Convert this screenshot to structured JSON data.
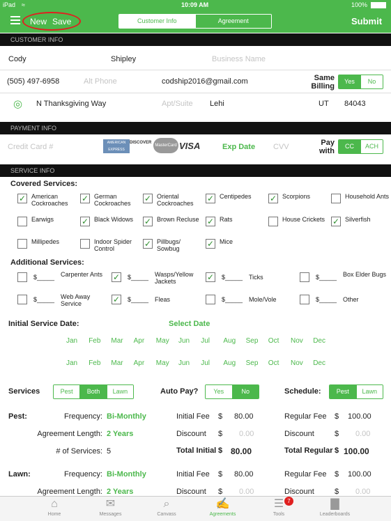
{
  "status": {
    "carrier": "iPad",
    "time": "10:09 AM",
    "battery": "100%"
  },
  "nav": {
    "new": "New",
    "save": "Save",
    "tabs": [
      "Customer Info",
      "Agreement"
    ],
    "submit": "Submit"
  },
  "sections": {
    "customer": "CUSTOMER INFO",
    "payment": "PAYMENT INFO",
    "service": "SERVICE INFO"
  },
  "customer": {
    "first": "Cody",
    "last": "Shipley",
    "business_ph": "Business Name",
    "phone": "(505) 497-6958",
    "alt_phone_ph": "Alt Phone",
    "email": "codship2016@gmail.com",
    "same_billing": "Same Billing",
    "yes": "Yes",
    "no": "No",
    "street": "N Thanksgiving Way",
    "apt_ph": "Apt/Suite",
    "city": "Lehi",
    "state": "UT",
    "zip": "84043"
  },
  "payment": {
    "cc_ph": "Credit Card #",
    "exp": "Exp Date",
    "cvv": "CVV",
    "pay_with": "Pay with",
    "cc": "CC",
    "ach": "ACH",
    "cards": [
      "AMERICAN EXPRESS",
      "DISCOVER",
      "MasterCard",
      "VISA"
    ]
  },
  "covered": {
    "title": "Covered Services:",
    "items": [
      {
        "label": "American Cockroaches",
        "checked": true
      },
      {
        "label": "German Cockroaches",
        "checked": true
      },
      {
        "label": "Oriental Cockroaches",
        "checked": true
      },
      {
        "label": "Centipedes",
        "checked": true
      },
      {
        "label": "Scorpions",
        "checked": true
      },
      {
        "label": "Household Ants",
        "checked": false
      },
      {
        "label": "Earwigs",
        "checked": false
      },
      {
        "label": "Black Widows",
        "checked": true
      },
      {
        "label": "Brown Recluse",
        "checked": true
      },
      {
        "label": "Rats",
        "checked": true
      },
      {
        "label": "House Crickets",
        "checked": false
      },
      {
        "label": "Silverfish",
        "checked": true
      },
      {
        "label": "Millipedes",
        "checked": false
      },
      {
        "label": "Indoor Spider Control",
        "checked": false
      },
      {
        "label": "Pillbugs/ Sowbug",
        "checked": true
      },
      {
        "label": "Mice",
        "checked": true
      }
    ]
  },
  "additional": {
    "title": "Additional Services:",
    "items": [
      {
        "label": "Carpenter Ants",
        "checked": false
      },
      {
        "label": "Wasps/Yellow Jackets",
        "checked": true
      },
      {
        "label": "Ticks",
        "checked": true
      },
      {
        "label": "Box Elder Bugs",
        "checked": false
      },
      {
        "label": "Web Away Service",
        "checked": false
      },
      {
        "label": "Fleas",
        "checked": true
      },
      {
        "label": "Mole/Vole",
        "checked": false
      },
      {
        "label": "Other",
        "checked": false
      }
    ],
    "price": "$_____"
  },
  "initial": {
    "label": "Initial Service Date:",
    "select": "Select Date",
    "months": [
      "Jan",
      "Feb",
      "Mar",
      "Apr",
      "May",
      "Jun",
      "Jul",
      "Aug",
      "Sep",
      "Oct",
      "Nov",
      "Dec"
    ]
  },
  "controls": {
    "services": "Services",
    "svc_opts": [
      "Pest",
      "Both",
      "Lawn"
    ],
    "autopay": "Auto Pay?",
    "ap_opts": [
      "Yes",
      "No"
    ],
    "schedule": "Schedule:",
    "sch_opts": [
      "Pest",
      "Lawn"
    ]
  },
  "pest": {
    "title": "Pest:",
    "freq_l": "Frequency:",
    "freq": "Bi-Monthly",
    "len_l": "Agreement Length:",
    "len": "2 Years",
    "num_l": "# of Services:",
    "num": "5",
    "init_fee_l": "Initial Fee",
    "init_fee": "80.00",
    "disc_l": "Discount",
    "disc": "0.00",
    "tot_init_l": "Total Initial",
    "tot_init": "80.00",
    "reg_fee_l": "Regular Fee",
    "reg_fee": "100.00",
    "disc2": "0.00",
    "tot_reg_l": "Total Regular",
    "tot_reg": "100.00",
    "dollar": "$"
  },
  "lawn": {
    "title": "Lawn:",
    "freq_l": "Frequency:",
    "freq": "Bi-Monthly",
    "len_l": "Agreement Length:",
    "len": "2 Years",
    "init_fee_l": "Initial Fee",
    "init_fee": "80.00",
    "disc_l": "Discount",
    "disc": "0.00",
    "reg_fee_l": "Regular Fee",
    "reg_fee": "100.00",
    "disc2": "0.00",
    "dollar": "$"
  },
  "tabbar": [
    {
      "label": "Home",
      "icon": "home-icon"
    },
    {
      "label": "Messages",
      "icon": "messages-icon"
    },
    {
      "label": "Canvass",
      "icon": "canvass-icon"
    },
    {
      "label": "Agreements",
      "icon": "agreements-icon"
    },
    {
      "label": "Tools",
      "icon": "tools-icon",
      "badge": "7"
    },
    {
      "label": "Leaderboards",
      "icon": "leaderboards-icon"
    }
  ]
}
